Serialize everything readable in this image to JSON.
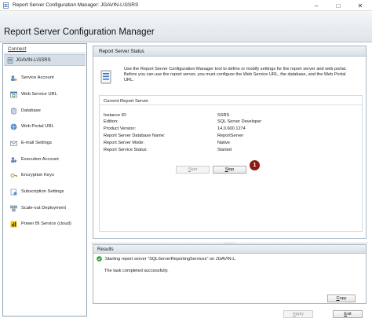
{
  "window": {
    "title": "Report Server Configuration Manager: JGAVIN-L\\SSRS",
    "minimize_glyph": "–",
    "maximize_glyph": "□",
    "close_glyph": "✕"
  },
  "header": {
    "app_title": "Report Server Configuration Manager"
  },
  "sidebar": {
    "connect_label": "Connect",
    "server_node": "JGAVIN-L\\SSRS",
    "items": [
      {
        "label": "Service Account",
        "icon": "service-account-icon"
      },
      {
        "label": "Web Service URL",
        "icon": "web-service-url-icon"
      },
      {
        "label": "Database",
        "icon": "database-icon"
      },
      {
        "label": "Web Portal URL",
        "icon": "web-portal-url-icon"
      },
      {
        "label": "E-mail Settings",
        "icon": "email-settings-icon"
      },
      {
        "label": "Execution Account",
        "icon": "execution-account-icon"
      },
      {
        "label": "Encryption Keys",
        "icon": "encryption-keys-icon"
      },
      {
        "label": "Subscription Settings",
        "icon": "subscription-settings-icon"
      },
      {
        "label": "Scale-out Deployment",
        "icon": "scale-out-deployment-icon"
      },
      {
        "label": "Power BI Service (cloud)",
        "icon": "power-bi-service-icon"
      }
    ]
  },
  "status_panel": {
    "title": "Report Server Status",
    "intro_line1": "Use the Report Server Configuration Manager tool to define or modify settings for the report server and web portal.",
    "intro_line2": "Before you can use the report server, you must configure the Web Service URL, the database, and the Web Portal",
    "intro_line3": "URL.",
    "current_server_label": "Current Report Server",
    "rows": [
      {
        "key": "Instance ID:",
        "value": "SSRS"
      },
      {
        "key": "Edition:",
        "value": "SQL Server Developer"
      },
      {
        "key": "Product Version:",
        "value": "14.0.600.1274"
      },
      {
        "key": "Report Server Database Name:",
        "value": "ReportServer"
      },
      {
        "key": "Report Server Mode:",
        "value": "Native"
      },
      {
        "key": "Report Service Status:",
        "value": "Started"
      }
    ],
    "start_label": "Start",
    "stop_label": "Stop",
    "callout_number": "1"
  },
  "results": {
    "title": "Results",
    "message": "Starting report server \"SQLServerReportingServices\" on JGAVIN-L.",
    "completion": "The task completed successfully.",
    "copy_label": "Copy"
  },
  "footer": {
    "apply_label": "Apply",
    "exit_label": "Exit"
  },
  "colors": {
    "accent": "#8b1a12",
    "success": "#2e9b3a",
    "header_band": "#dfe5ea"
  }
}
